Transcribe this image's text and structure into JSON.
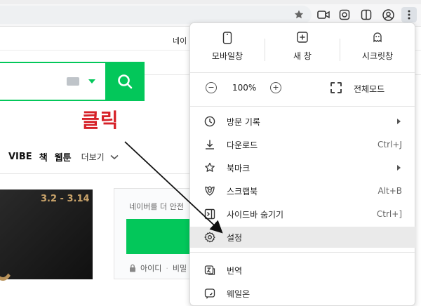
{
  "browser": {
    "toolbar_icons": [
      "extension-star-icon",
      "video-icon",
      "screenshot-icon",
      "split-icon",
      "profile-icon",
      "menu-dots-icon"
    ]
  },
  "page": {
    "top_link": "네이",
    "nav": {
      "items": [
        "VIBE",
        "책",
        "웹툰"
      ],
      "more": "더보기"
    },
    "banner": {
      "date": "3.2 - 3.14"
    },
    "login": {
      "message": "네이버를 더 안전",
      "links": [
        "아이디",
        "비밀"
      ]
    }
  },
  "annotation": {
    "text": "클릭",
    "color": "#d62128"
  },
  "menu": {
    "top_actions": [
      {
        "label": "모바일창",
        "icon": "mobile-icon"
      },
      {
        "label": "새 창",
        "icon": "new-window-icon"
      },
      {
        "label": "시크릿창",
        "icon": "incognito-icon"
      }
    ],
    "zoom": {
      "minus": "−",
      "value": "100%",
      "plus": "+",
      "fullscreen_label": "전체모드"
    },
    "items": [
      {
        "label": "방문 기록",
        "shortcut": "",
        "submenu": true,
        "icon": "history-icon"
      },
      {
        "label": "다운로드",
        "shortcut": "Ctrl+J",
        "submenu": false,
        "icon": "download-icon"
      },
      {
        "label": "북마크",
        "shortcut": "",
        "submenu": true,
        "icon": "bookmark-star-icon"
      },
      {
        "label": "스크랩북",
        "shortcut": "Alt+B",
        "submenu": false,
        "icon": "scrapbook-icon"
      },
      {
        "label": "사이드바 숨기기",
        "shortcut": "Ctrl+]",
        "submenu": false,
        "icon": "sidebar-icon"
      },
      {
        "label": "설정",
        "shortcut": "",
        "submenu": false,
        "icon": "gear-icon",
        "selected": true
      },
      {
        "label": "번역",
        "shortcut": "",
        "submenu": false,
        "icon": "translate-icon"
      },
      {
        "label": "웨일온",
        "shortcut": "",
        "submenu": false,
        "icon": "whale-on-icon"
      }
    ]
  },
  "colors": {
    "naver_green": "#03c75a",
    "annotation_red": "#d62128",
    "selected_bg": "#eaeaea"
  }
}
